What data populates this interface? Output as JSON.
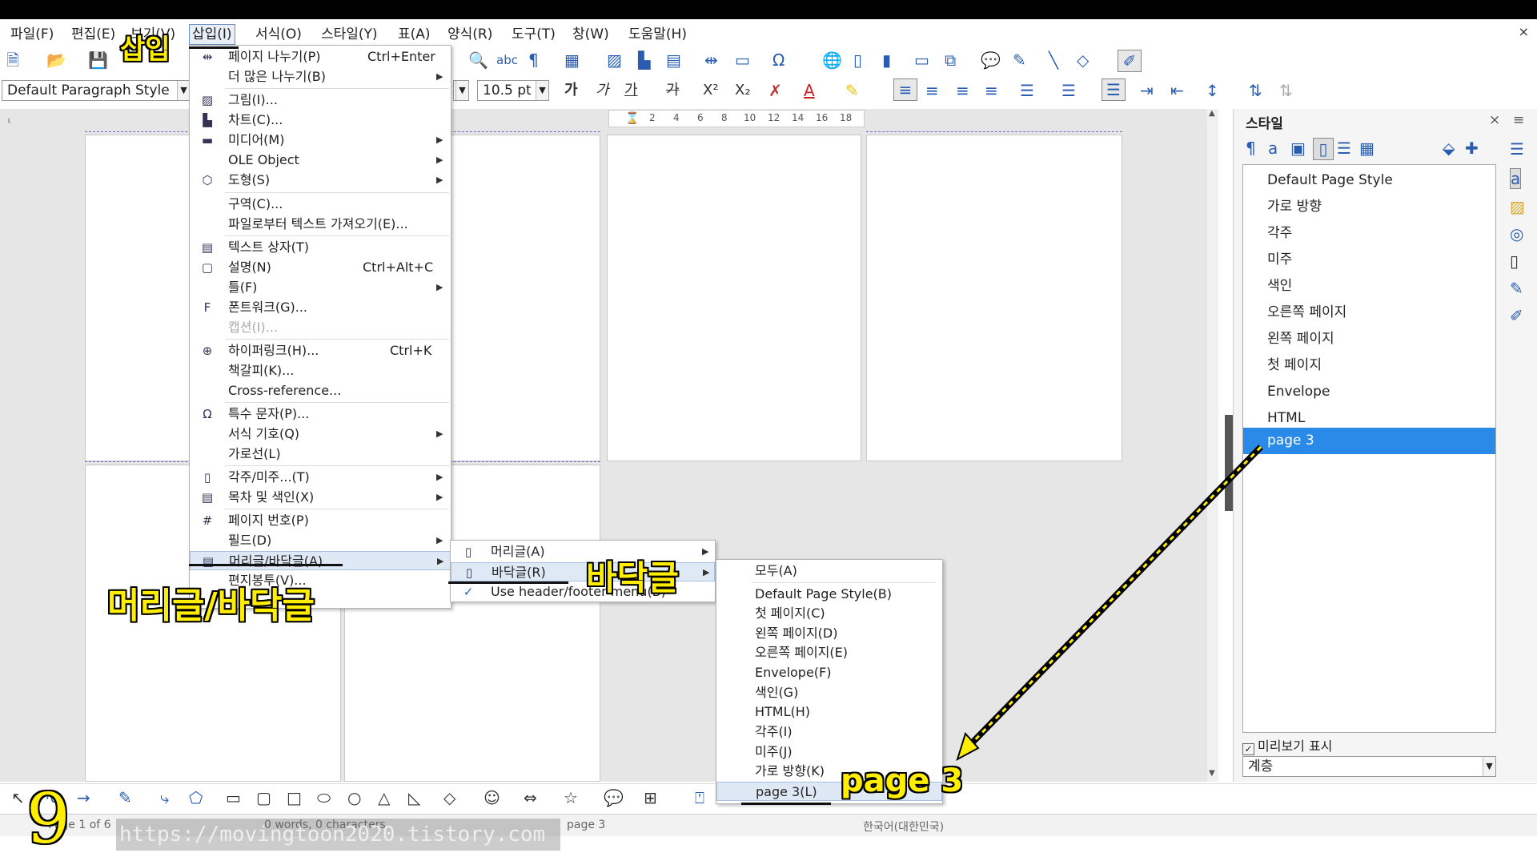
{
  "menubar": {
    "items": [
      "파일(F)",
      "편집(E)",
      "보기(V)",
      "삽입(I)",
      "서식(O)",
      "스타일(Y)",
      "표(A)",
      "양식(R)",
      "도구(T)",
      "창(W)",
      "도움말(H)"
    ],
    "close_glyph": "×"
  },
  "toolbar": {
    "paragraph_style": "Default Paragraph Style",
    "font_size": "10.5 pt",
    "bold": "가",
    "italic": "가",
    "underline": "가",
    "strike": "가",
    "superscript": "X²",
    "subscript": "X₂"
  },
  "ruler": {
    "ticks": [
      "2",
      "4",
      "6",
      "8",
      "10",
      "12",
      "14",
      "16",
      "18"
    ]
  },
  "insert_menu": {
    "items": [
      {
        "label": "페이지 나누기(P)",
        "shortcut": "Ctrl+Enter"
      },
      {
        "label": "더 많은 나누기(B)"
      },
      {
        "label": "그림(I)..."
      },
      {
        "label": "차트(C)..."
      },
      {
        "label": "미디어(M)"
      },
      {
        "label": "OLE Object"
      },
      {
        "label": "도형(S)"
      },
      {
        "label": "구역(C)..."
      },
      {
        "label": "파일로부터 텍스트 가져오기(E)..."
      },
      {
        "label": "텍스트 상자(T)"
      },
      {
        "label": "설명(N)",
        "shortcut": "Ctrl+Alt+C"
      },
      {
        "label": "틀(F)"
      },
      {
        "label": "폰트워크(G)..."
      },
      {
        "label": "캡션(I)..."
      },
      {
        "label": "하이퍼링크(H)...",
        "shortcut": "Ctrl+K"
      },
      {
        "label": "책갈피(K)..."
      },
      {
        "label": "Cross-reference..."
      },
      {
        "label": "특수 문자(P)..."
      },
      {
        "label": "서식 기호(Q)"
      },
      {
        "label": "가로선(L)"
      },
      {
        "label": "각주/미주...(T)"
      },
      {
        "label": "목차 및 색인(X)"
      },
      {
        "label": "페이지 번호(P)"
      },
      {
        "label": "필드(D)"
      },
      {
        "label": "머리글/바닥글(A)"
      },
      {
        "label": "편지봉투(V)..."
      }
    ]
  },
  "hf_submenu": {
    "items": [
      {
        "label": "머리글(A)"
      },
      {
        "label": "바닥글(R)"
      },
      {
        "label": "Use header/footer menu(B)"
      }
    ]
  },
  "footer_submenu": {
    "items": [
      "모두(A)",
      "Default Page Style(B)",
      "첫 페이지(C)",
      "왼쪽 페이지(D)",
      "오른쪽 페이지(E)",
      "Envelope(F)",
      "색인(G)",
      "HTML(H)",
      "각주(I)",
      "미주(J)",
      "가로 방향(K)",
      "page 3(L)"
    ]
  },
  "sidebar": {
    "title": "스타일",
    "close": "×",
    "menu": "≡",
    "styles": [
      "Default Page Style",
      "가로 방향",
      "각주",
      "미주",
      "색인",
      "오른쪽 페이지",
      "왼쪽 페이지",
      "첫 페이지",
      "Envelope",
      "HTML",
      "page 3"
    ],
    "selected_index": 10,
    "preview_label": "미리보기 표시",
    "preview_checked": "✓",
    "filter_value": "계층"
  },
  "annotations": {
    "insert": "삽입",
    "header_footer": "머리글/바닥글",
    "footer": "바닥글",
    "page3": "page 3",
    "step": "9"
  },
  "statusbar": {
    "page": "Page 1 of 6",
    "words": "0 words, 0 characters",
    "style": "page 3",
    "language": "한국어(대한민국)"
  },
  "watermark": "https://movingtoon2020.tistory.com",
  "colors": {
    "selection": "#2a8ae8",
    "annotation": "#ffee00",
    "page_border": "#c8c8c8"
  }
}
